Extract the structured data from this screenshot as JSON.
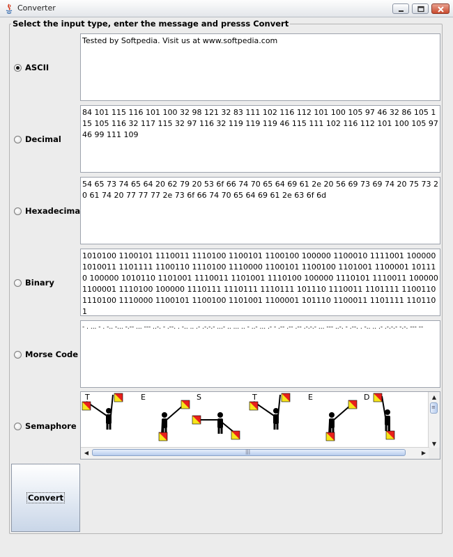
{
  "window": {
    "title": "Converter"
  },
  "panel": {
    "legend": "Select the input type, enter the message and presss Convert"
  },
  "rows": [
    {
      "label": "ASCII",
      "checked": true,
      "text": "Tested by Softpedia. Visit us at www.softpedia.com"
    },
    {
      "label": "Decimal",
      "checked": false,
      "text": "84 101 115 116 101 100 32 98 121 32 83 111 102 116 112 101 100 105 97 46 32 86 105 115 105 116 32 117 115 32 97 116 32 119 119 119 46 115 111 102 116 112 101 100 105 97 46 99 111 109"
    },
    {
      "label": "Hexadecimal",
      "checked": false,
      "text": "54 65 73 74 65 64 20 62 79 20 53 6f 66 74 70 65 64 69 61 2e 20 56 69 73 69 74 20 75 73 20 61 74 20 77 77 77 2e 73 6f 66 74 70 65 64 69 61 2e 63 6f 6d"
    },
    {
      "label": "Binary",
      "checked": false,
      "text": "1010100 1100101 1110011 1110100 1100101 1100100 100000 1100010 1111001 100000 1010011 1101111 1100110 1110100 1110000 1100101 1100100 1101001 1100001 101110 100000 1010110 1101001 1110011 1101001 1110100 100000 1110101 1110011 100000 1100001 1110100 100000 1110111 1110111 1110111 101110 1110011 1101111 1100110 1110100 1110000 1100101 1100100 1101001 1100001 101110 1100011 1101111 1101101"
    },
    {
      "label": "Morse Code",
      "checked": false,
      "text": "- . ... - . -..  -... -.--  ... --- ..-. - .--. . -.. .. .- .-.-.-  ...- .. ... .. -  ..- ...  .- -  .-- .-- .-- .-.-.- ... --- ..-. - .--. . -.. .. .- .-.-.- -.-. --- --"
    }
  ],
  "semaphore": {
    "label": "Semaphore",
    "checked": false,
    "letters": [
      "T",
      "E",
      "S",
      "T",
      "E",
      "D"
    ]
  },
  "convert_button": {
    "label": "Convert"
  },
  "colors": {
    "flag_red": "#e8201c",
    "flag_yellow": "#f7e51a"
  }
}
